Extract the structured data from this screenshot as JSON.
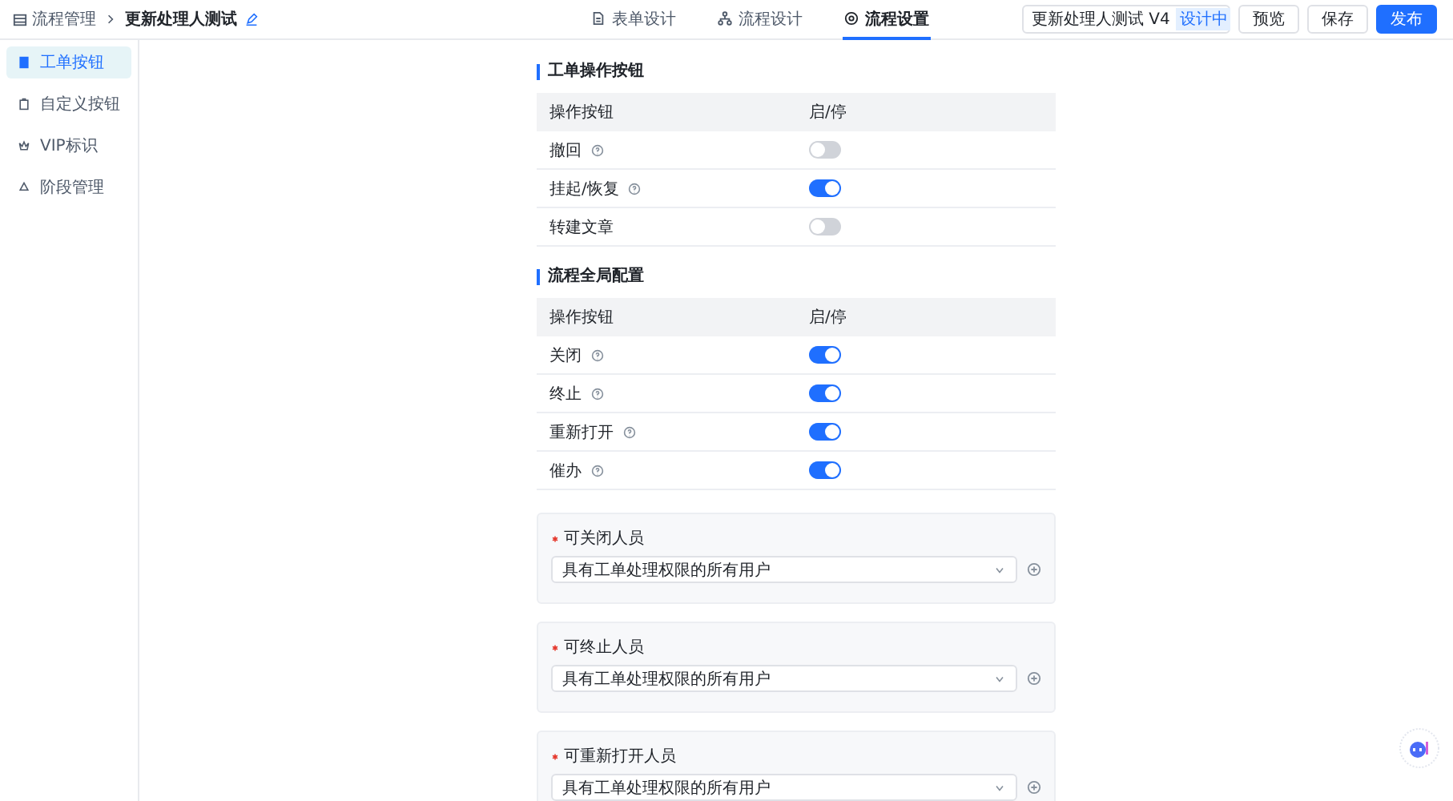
{
  "breadcrumb": {
    "parent": "流程管理",
    "current": "更新处理人测试"
  },
  "tabs": [
    {
      "label": "表单设计",
      "selected": false
    },
    {
      "label": "流程设计",
      "selected": false
    },
    {
      "label": "流程设置",
      "selected": true
    }
  ],
  "version": {
    "name": "更新处理人测试 V4",
    "status": "设计中"
  },
  "buttons": [
    {
      "label": "预览",
      "kind": "default"
    },
    {
      "label": "保存",
      "kind": "default"
    },
    {
      "label": "发布",
      "kind": "primary"
    }
  ],
  "sidebar": {
    "items": [
      {
        "label": "工单按钮",
        "selected": true
      },
      {
        "label": "自定义按钮",
        "selected": false
      },
      {
        "label": "VIP标识",
        "selected": false
      },
      {
        "label": "阶段管理",
        "selected": false
      }
    ]
  },
  "sections": [
    {
      "title": "工单操作按钮",
      "columns": [
        "操作按钮",
        "启/停"
      ],
      "rows": [
        {
          "name": "撤回",
          "help": true,
          "on": false
        },
        {
          "name": "挂起/恢复",
          "help": true,
          "on": true
        },
        {
          "name": "转建文章",
          "help": false,
          "on": false
        }
      ]
    },
    {
      "title": "流程全局配置",
      "columns": [
        "操作按钮",
        "启/停"
      ],
      "rows": [
        {
          "name": "关闭",
          "help": true,
          "on": true
        },
        {
          "name": "终止",
          "help": true,
          "on": true
        },
        {
          "name": "重新打开",
          "help": true,
          "on": true
        },
        {
          "name": "催办",
          "help": true,
          "on": true
        }
      ]
    }
  ],
  "people_fields": [
    {
      "label": "可关闭人员",
      "required": true,
      "value": "具有工单处理权限的所有用户"
    },
    {
      "label": "可终止人员",
      "required": true,
      "value": "具有工单处理权限的所有用户"
    },
    {
      "label": "可重新打开人员",
      "required": true,
      "value": "具有工单处理权限的所有用户"
    }
  ]
}
